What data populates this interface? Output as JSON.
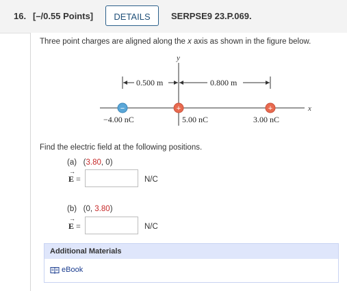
{
  "header": {
    "question_number": "16.",
    "points": "[–/0.55 Points]",
    "details_label": "DETAILS",
    "problem_id": "SERPSE9 23.P.069."
  },
  "problem": {
    "intro_pre": "Three point charges are aligned along the ",
    "intro_axis": "x",
    "intro_post": " axis as shown in the figure below.",
    "prompt": "Find the electric field at the following positions."
  },
  "figure": {
    "y_axis_label": "y",
    "x_axis_label": "x",
    "dist_left": "0.500 m",
    "dist_right": "0.800 m",
    "charges": [
      {
        "label": "−4.00 nC",
        "sign": "−",
        "color": "#5aa7d8"
      },
      {
        "label": "5.00 nC",
        "sign": "+",
        "color": "#e86a4f"
      },
      {
        "label": "3.00 nC",
        "sign": "+",
        "color": "#e86a4f"
      }
    ]
  },
  "parts": [
    {
      "letter": "(a)",
      "pos_open": "(",
      "pos_first": "3.80",
      "pos_mid": ", ",
      "pos_second": "0",
      "pos_close": ")",
      "answer_value": "",
      "unit": "N/C"
    },
    {
      "letter": "(b)",
      "pos_open": "(",
      "pos_first": "0",
      "pos_mid": ", ",
      "pos_second": "3.80",
      "pos_close": ")",
      "answer_value": "",
      "unit": "N/C"
    }
  ],
  "evec_label": "E",
  "evec_equals": "=",
  "additional_materials": {
    "title": "Additional Materials",
    "ebook_label": "eBook"
  }
}
